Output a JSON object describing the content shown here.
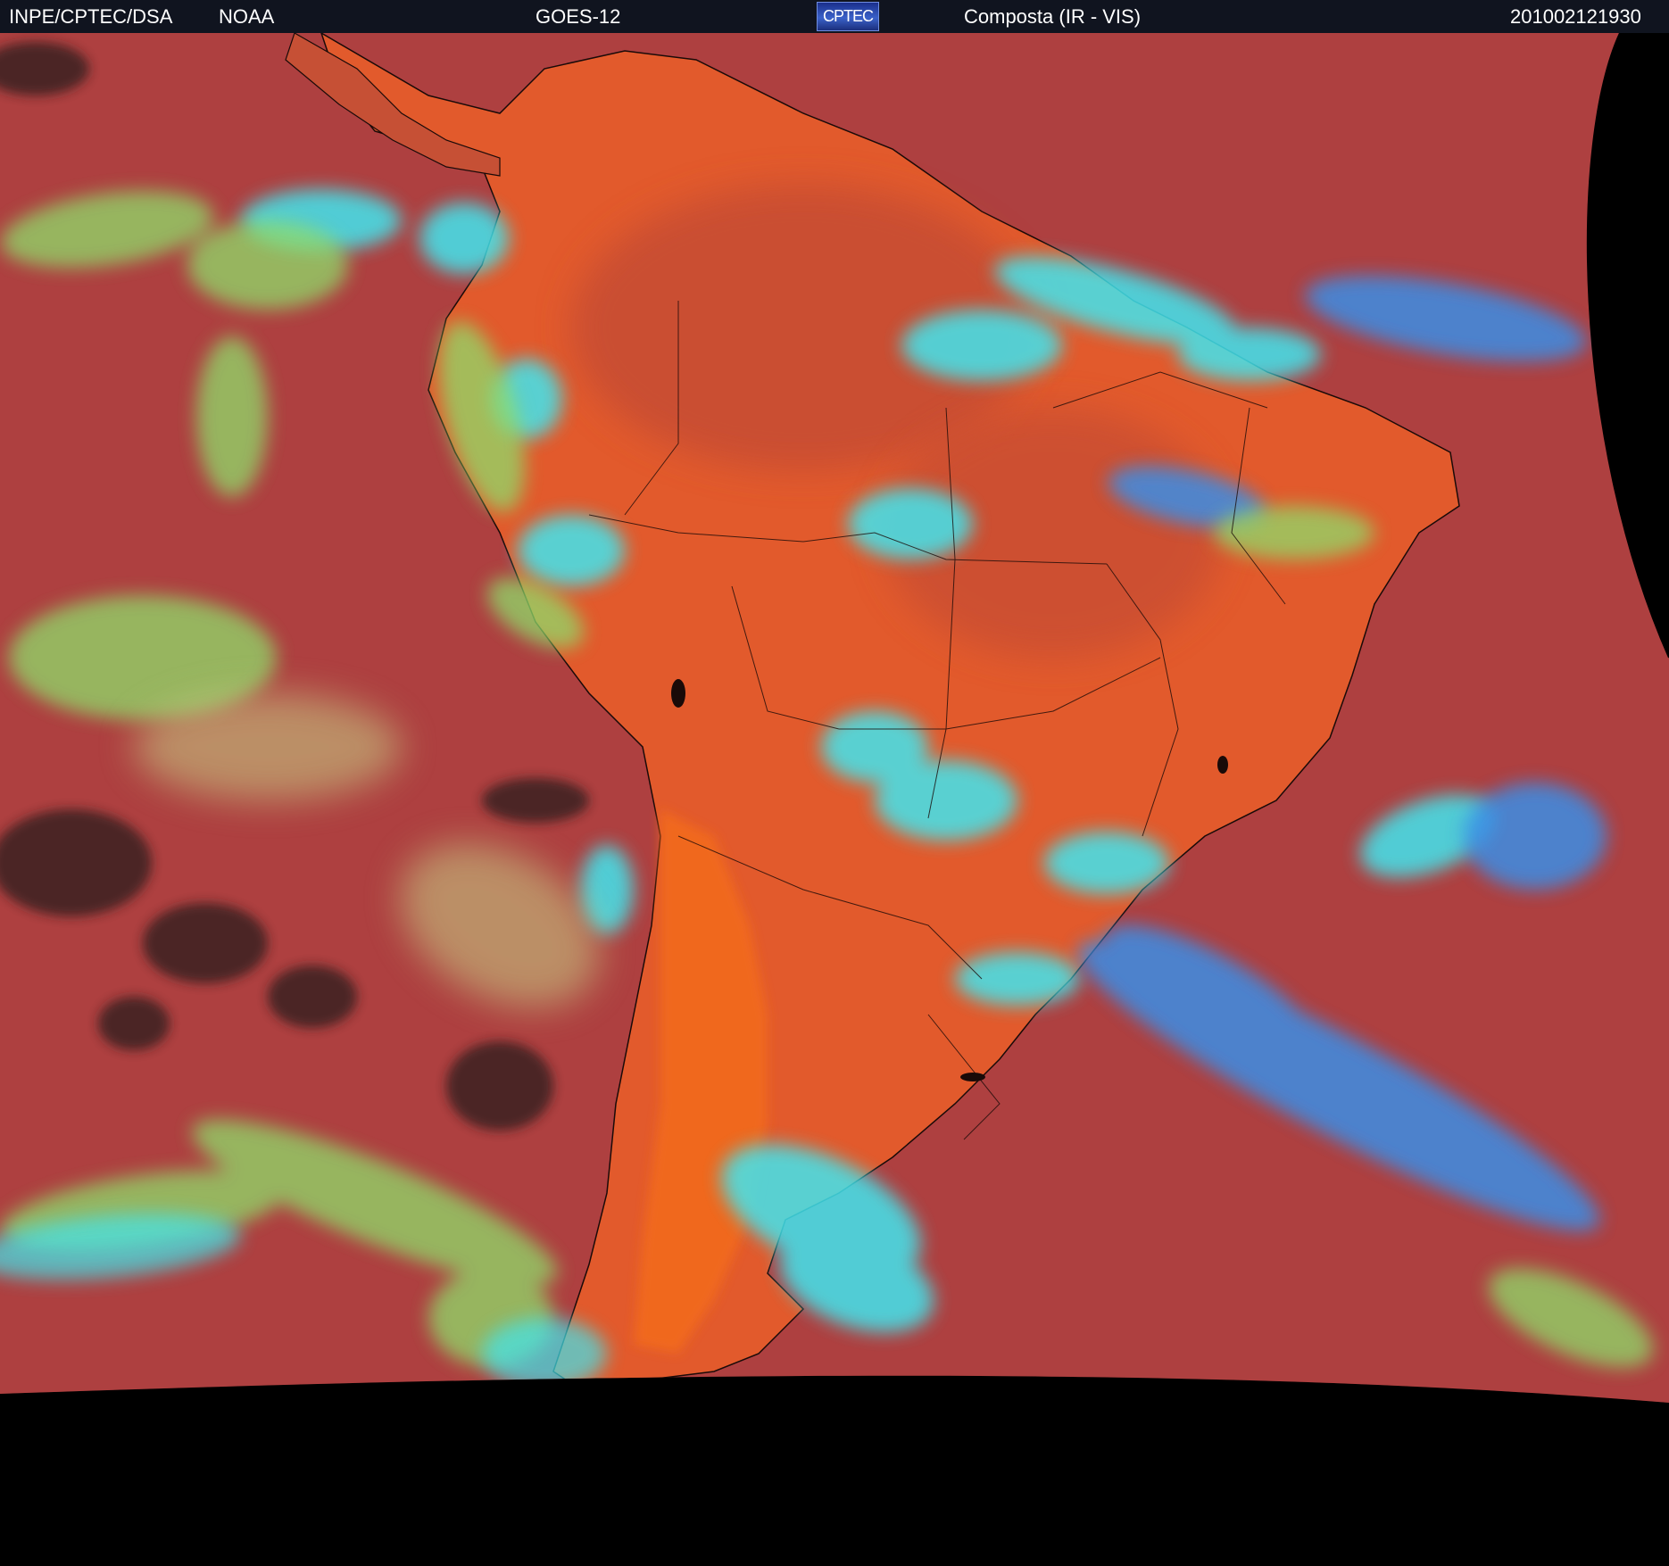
{
  "header": {
    "agency": "INPE/CPTEC/DSA",
    "source": "NOAA",
    "satellite": "GOES-12",
    "logo_text": "CPTEC",
    "product": "Composta (IR - VIS)",
    "timestamp": "201002121930"
  },
  "colors": {
    "header_bg": "#10141f",
    "no_data": "#000000",
    "ocean_clear": "#b3423e",
    "land_clear": "#e6582a",
    "high_cloud": "#41e6f0",
    "mid_cloud": "#8fdc6a",
    "low_cloud_blue": "#3b8ee6",
    "coastline": "#000000"
  },
  "icons": {
    "logo": "cptec-logo"
  }
}
